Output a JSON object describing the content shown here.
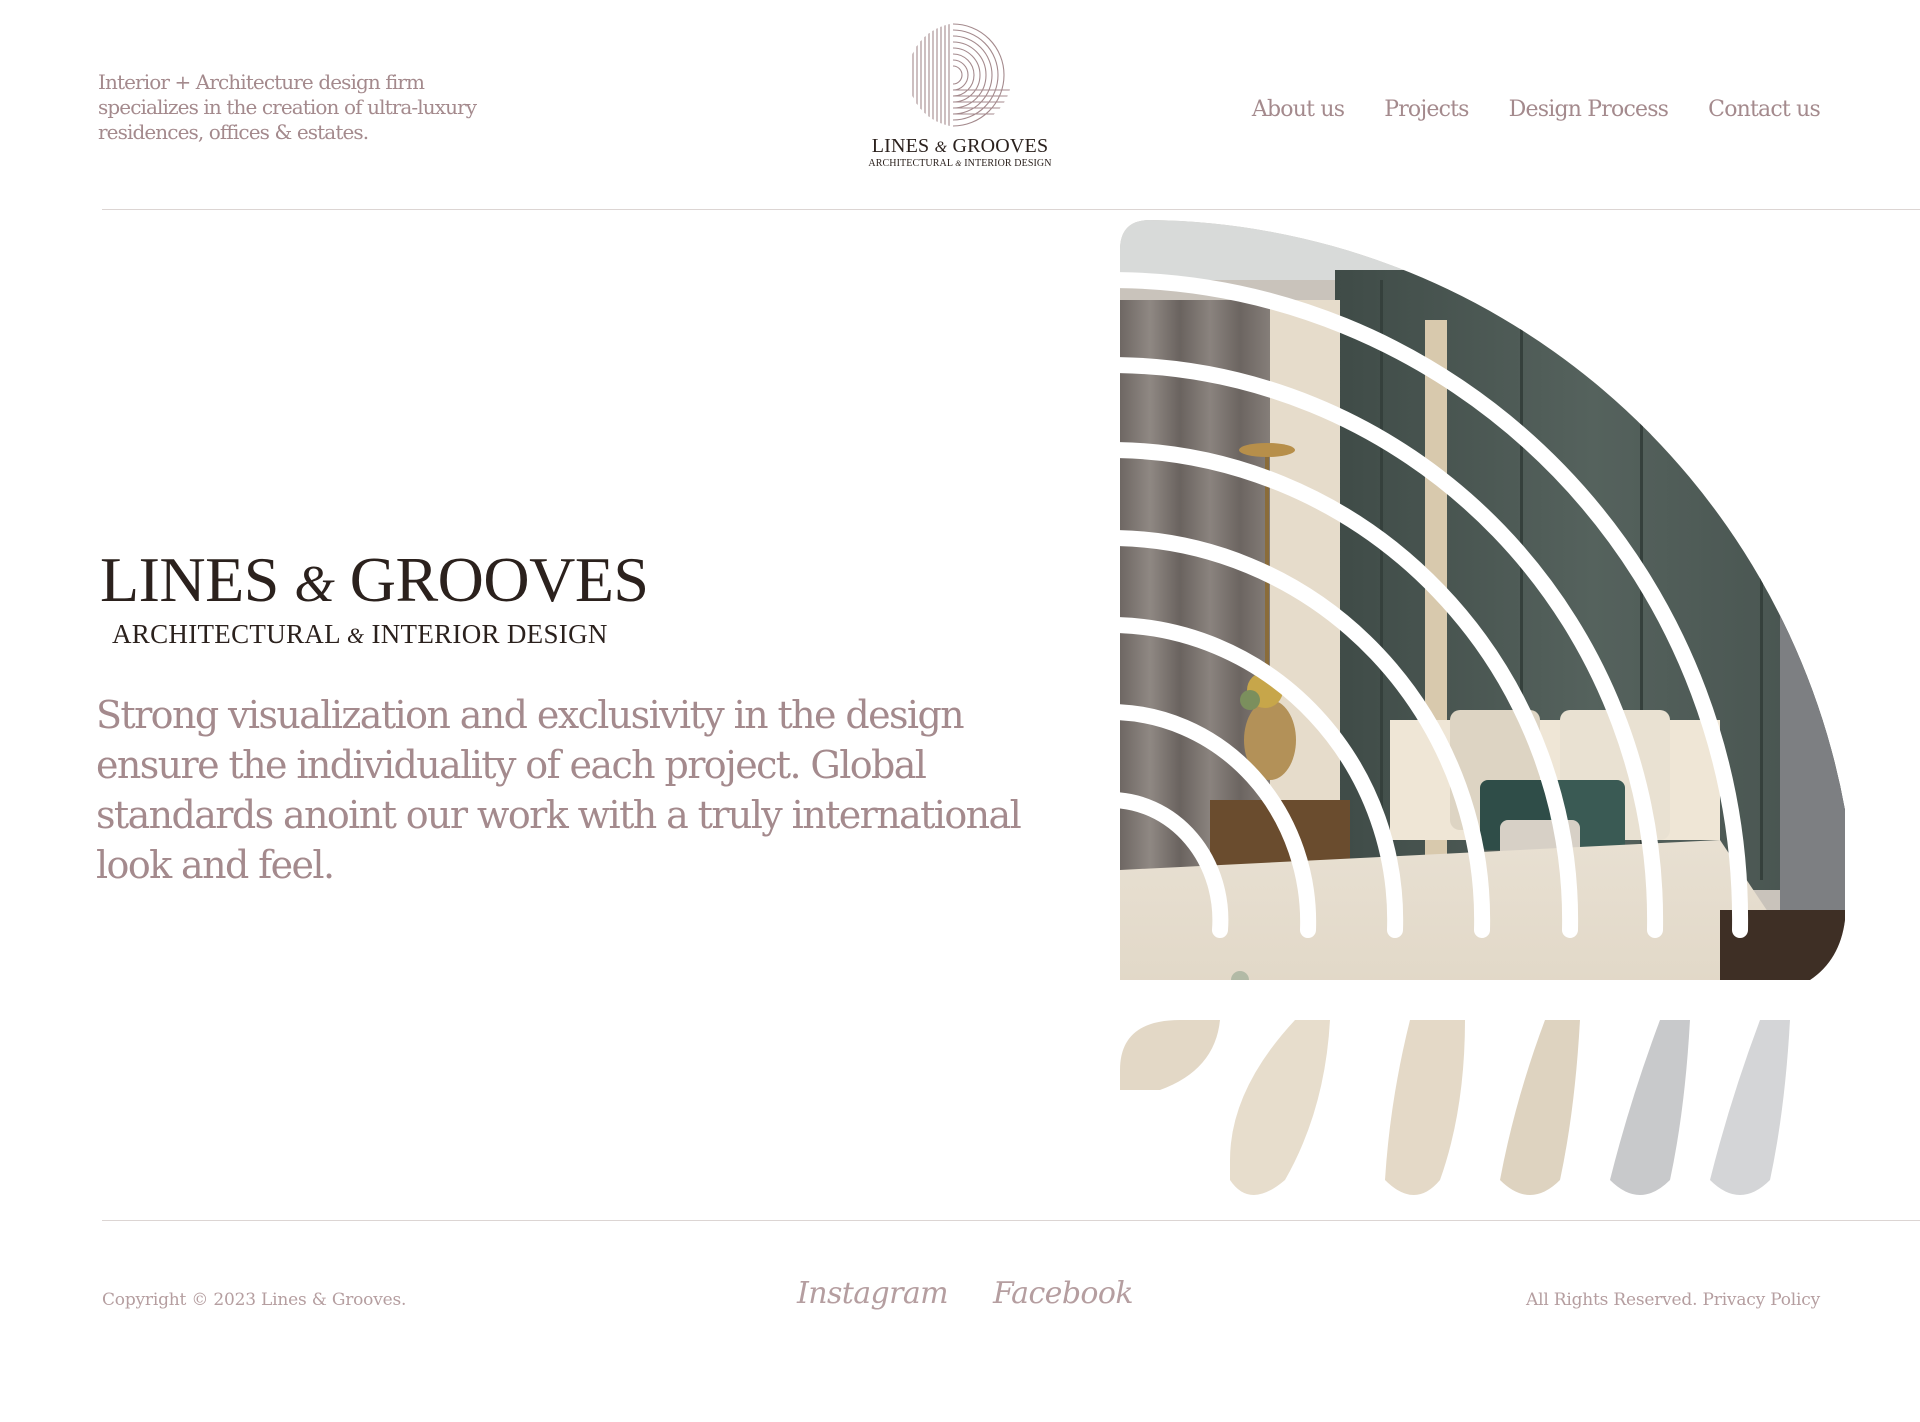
{
  "header": {
    "tagline": "Interior + Architecture design firm specializes in the creation of ultra-luxury residences, offices & estates.",
    "logo": {
      "name_left": "LINES",
      "ampersand": "&",
      "name_right": "GROOVES",
      "sub_left": "ARCHITECTURAL",
      "sub_right": "INTERIOR DESIGN"
    },
    "nav": [
      {
        "label": "About us"
      },
      {
        "label": "Projects"
      },
      {
        "label": "Design Process"
      },
      {
        "label": "Contact us"
      }
    ]
  },
  "hero": {
    "brand": {
      "name_left": "LINES",
      "ampersand": "&",
      "name_right": "GROOVES",
      "sub_left": "ARCHITECTURAL",
      "sub_right": "INTERIOR DESIGN"
    },
    "description": "Strong visualization and exclusivity in the design ensure the individuality of each project. Global standards anoint our work with a truly international look and feel.",
    "image_icon": "bedroom-interior-photo"
  },
  "footer": {
    "copyright": "Copyright © 2023 Lines & Grooves.",
    "social": [
      {
        "label": "Instagram"
      },
      {
        "label": "Facebook"
      }
    ],
    "rights": "All Rights Reserved.",
    "privacy": "Privacy Policy"
  },
  "colors": {
    "accent": "#a48a8d",
    "brand_dark": "#2b211d",
    "rule": "#dcd5d3",
    "background": "#ffffff"
  }
}
